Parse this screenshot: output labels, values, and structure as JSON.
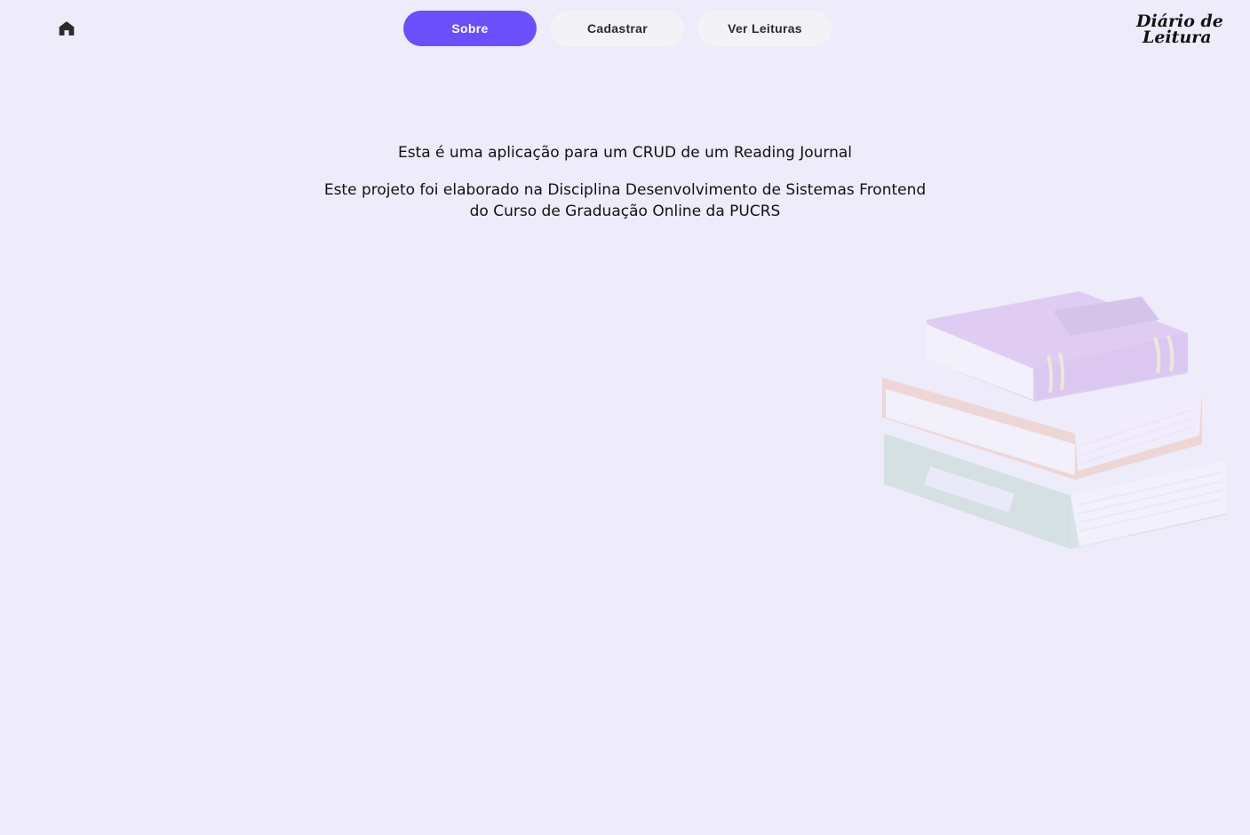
{
  "header": {
    "home_icon": "home-icon",
    "nav": [
      {
        "label": "Sobre",
        "active": true
      },
      {
        "label": "Cadastrar",
        "active": false
      },
      {
        "label": "Ver Leituras",
        "active": false
      }
    ],
    "logo": {
      "line1": "Diário de",
      "line2": "Leitura"
    }
  },
  "main": {
    "paragraph1": "Esta é uma aplicação para um CRUD de um Reading Journal",
    "paragraph2": "Este projeto foi elaborado na Disciplina Desenvolvimento de Sistemas Frontend do Curso de Graduação Online da PUCRS"
  },
  "illustration": {
    "icon": "books-stack-illustration"
  },
  "colors": {
    "background": "#eeecfb",
    "accent": "#6b4ffb",
    "button_inactive": "#f3f3f7"
  }
}
